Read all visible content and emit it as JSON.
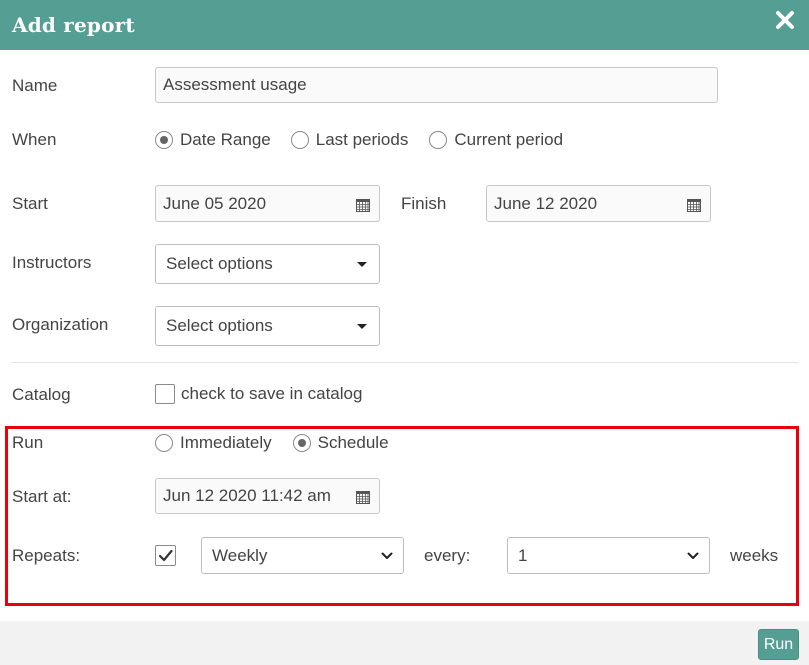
{
  "header": {
    "title": "Add report"
  },
  "form": {
    "name": {
      "label": "Name",
      "value": "Assessment usage"
    },
    "when": {
      "label": "When",
      "options": [
        "Date Range",
        "Last periods",
        "Current period"
      ],
      "selected": "Date Range"
    },
    "start": {
      "label": "Start",
      "value": "June 05 2020"
    },
    "finish": {
      "label": "Finish",
      "value": "June 12 2020"
    },
    "instructors": {
      "label": "Instructors",
      "value": "Select options"
    },
    "organization": {
      "label": "Organization",
      "value": "Select options"
    },
    "catalog": {
      "label": "Catalog",
      "checkbox_label": "check to save in catalog",
      "checked": false
    },
    "run": {
      "label": "Run",
      "options": [
        "Immediately",
        "Schedule"
      ],
      "selected": "Schedule"
    },
    "start_at": {
      "label": "Start at:",
      "value": "Jun 12 2020 11:42 am"
    },
    "repeats": {
      "label": "Repeats:",
      "checked": true,
      "frequency": "Weekly",
      "every_label": "every:",
      "interval": "1",
      "unit": "weeks"
    }
  },
  "footer": {
    "run_button": "Run"
  },
  "colors": {
    "header": "#559e94",
    "highlight": "#e8000b",
    "footer": "#f2f2f2"
  },
  "icons": [
    "close-icon",
    "calendar-icon",
    "caret-down-icon",
    "chevron-down-icon",
    "checkmark-icon"
  ]
}
